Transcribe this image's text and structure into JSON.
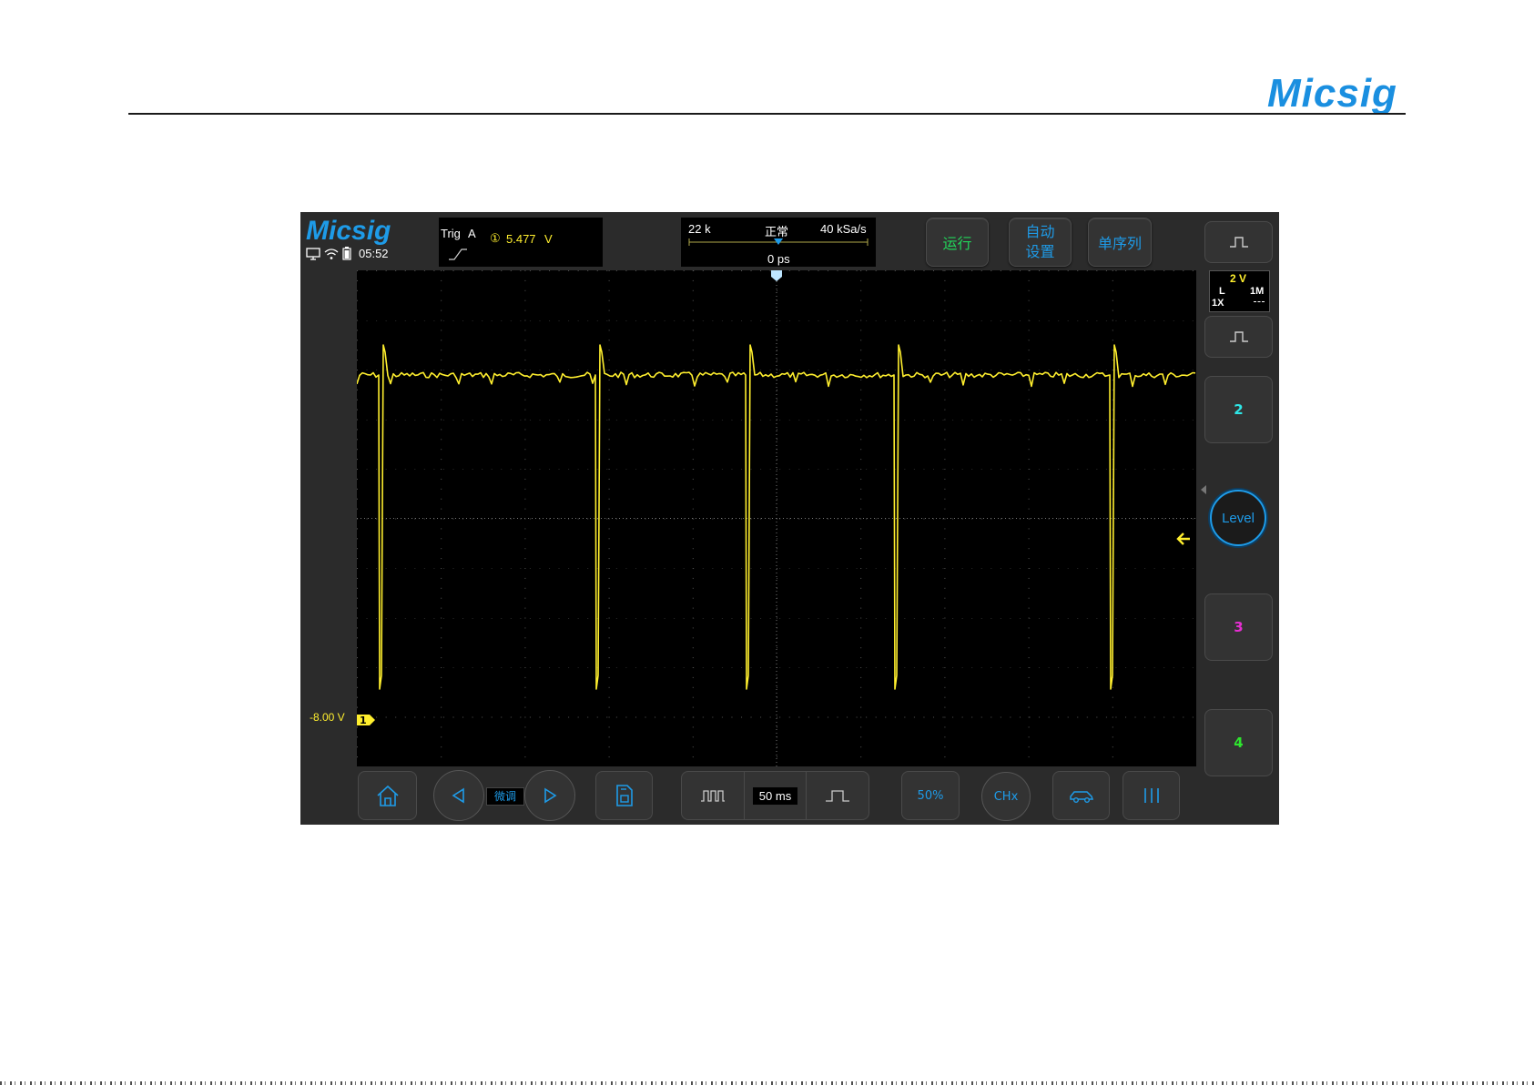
{
  "document": {
    "brand": "Micsig"
  },
  "scope": {
    "brand": "Micsig",
    "status": {
      "time": "05:52",
      "icons": [
        "monitor-icon",
        "wifi-icon",
        "battery-icon"
      ]
    },
    "trigger": {
      "label": "Trig",
      "source": "A",
      "channel_marker": "①",
      "level": "5.477",
      "unit": "V"
    },
    "timebase": {
      "memory": "22 k",
      "mode": "正常",
      "sample_rate": "40 kSa/s",
      "offset": "0 ps"
    },
    "buttons": {
      "run": "运行",
      "auto_line1": "自动",
      "auto_line2": "设置",
      "single": "单序列"
    },
    "channel1": {
      "scale": "2 V",
      "coupling": "L",
      "impedance": "1M",
      "probe": "1X",
      "offset_label": "-8.00 V",
      "marker": "1"
    },
    "side": {
      "ch2": "2",
      "level": "Level",
      "ch3": "3",
      "ch4": "4"
    },
    "bottom": {
      "fine": "微调",
      "timebase": "50 ms",
      "fifty": "50%",
      "chx": "CHx"
    },
    "colors": {
      "ch1": "#ffef2e",
      "ch2": "#2ee6e6",
      "ch3": "#e62ed2",
      "ch4": "#2ee62e",
      "accent": "#1e9be8",
      "run": "#22d65a"
    }
  }
}
